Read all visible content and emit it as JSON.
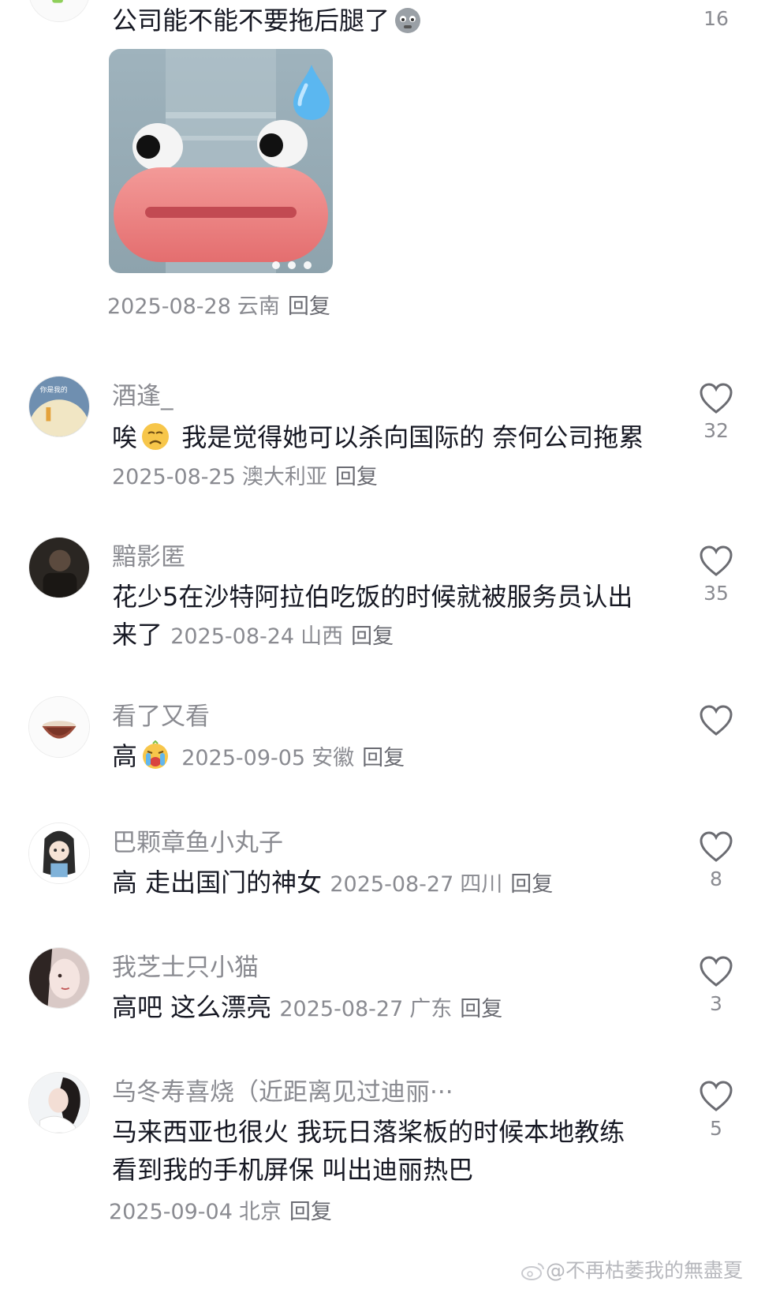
{
  "top_comment": {
    "text": "公司能不能不要拖后腿了",
    "date": "2025-08-28",
    "location": "云南",
    "reply_label": "回复",
    "likes": "16",
    "sticker_indicator_dots": 3
  },
  "comments": [
    {
      "username": "酒逢_",
      "text": "唉",
      "text2": " 我是觉得她可以杀向国际的 奈何公司拖累",
      "date": "2025-08-25",
      "location": "澳大利亚",
      "reply_label": "回复",
      "likes": "32",
      "emoji": "sad-face-emoji"
    },
    {
      "username": "黯影匿",
      "text": "花少5在沙特阿拉伯吃饭的时候就被服务员认出来了",
      "date": "2025-08-24",
      "location": "山西",
      "reply_label": "回复",
      "likes": "35"
    },
    {
      "username": "看了又看",
      "text": "高",
      "date": "2025-09-05",
      "location": "安徽",
      "reply_label": "回复",
      "likes": "",
      "emoji": "crying-face-emoji"
    },
    {
      "username": "巴颗章鱼小丸子",
      "text": "高 走出国门的神女",
      "date": "2025-08-27",
      "location": "四川",
      "reply_label": "回复",
      "likes": "8"
    },
    {
      "username": "我芝士只小猫",
      "text": "高吧 这么漂亮",
      "date": "2025-08-27",
      "location": "广东",
      "reply_label": "回复",
      "likes": "3"
    },
    {
      "username": "乌冬寿喜烧（近距离见过迪丽···",
      "text": "马来西亚也很火 我玩日落桨板的时候本地教练看到我的手机屏保 叫出迪丽热巴",
      "date": "2025-09-04",
      "location": "北京",
      "reply_label": "回复",
      "likes": "5"
    }
  ],
  "watermark": "@不再枯萎我的無盡夏",
  "colors": {
    "text": "#161823",
    "muted": "#8a8b91",
    "heart": "#6b6c72",
    "background": "#ffffff"
  },
  "icons": [
    "heart-outline-icon",
    "sad-face-emoji",
    "crying-face-emoji",
    "weibo-logo-icon"
  ]
}
